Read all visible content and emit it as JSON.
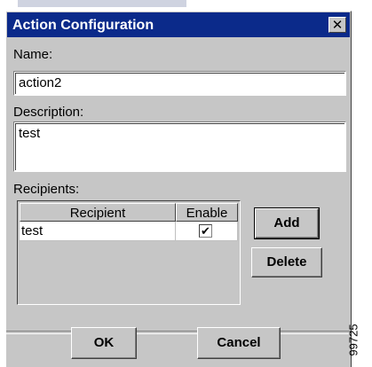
{
  "window": {
    "title": "Action Configuration"
  },
  "name": {
    "label": "Name:",
    "value": "action2"
  },
  "description": {
    "label": "Description:",
    "value": "test"
  },
  "recipients": {
    "label": "Recipients:",
    "columns": [
      "Recipient",
      "Enable"
    ],
    "rows": [
      {
        "recipient": "test",
        "enable": "✔"
      }
    ],
    "add_label": "Add",
    "delete_label": "Delete"
  },
  "footer": {
    "ok_label": "OK",
    "cancel_label": "Cancel"
  },
  "figure_id": "99725",
  "colors": {
    "titlebar": "#0b2a8a",
    "dialog": "#c6c6c6"
  }
}
